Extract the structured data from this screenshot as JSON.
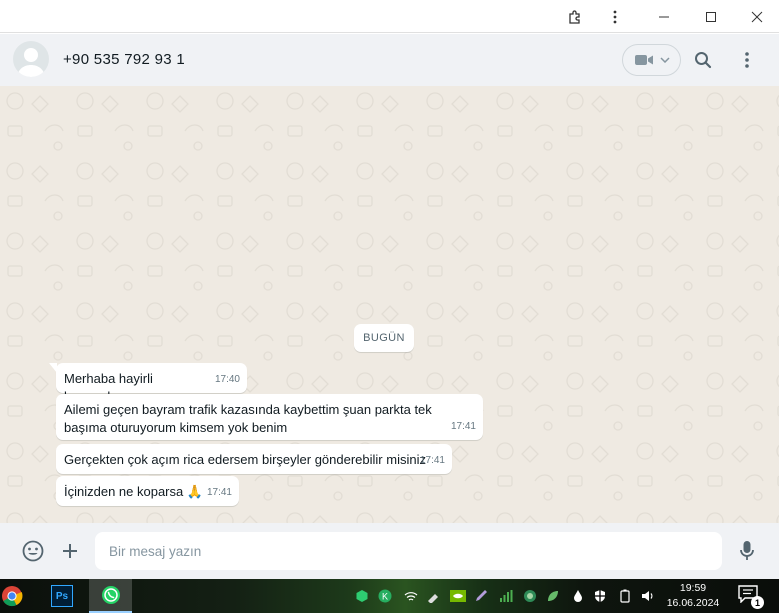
{
  "window": {
    "controls": [
      "extensions",
      "menu",
      "minimize",
      "maximize",
      "close"
    ]
  },
  "header": {
    "contact": "+90 535 792 93 1"
  },
  "chat": {
    "date_divider": "BUGÜN",
    "messages": [
      {
        "text": "Merhaba hayirli bayramlar",
        "time": "17:40"
      },
      {
        "text": "Ailemi geçen bayram trafik kazasında kaybettim şuan parkta tek başıma oturuyorum kimsem yok benim",
        "time": "17:41"
      },
      {
        "text": "Gerçekten çok açım rica edersem birşeyler gönderebilir misiniz",
        "time": "17:41"
      },
      {
        "text": "İçinizden ne koparsa 🙏",
        "time": "17:41"
      }
    ]
  },
  "composer": {
    "placeholder": "Bir mesaj yazın"
  },
  "taskbar": {
    "apps": [
      "chrome-icon",
      "photoshop-icon",
      "whatsapp-icon"
    ],
    "ps_label": "Ps",
    "clock_time": "19:59",
    "clock_date": "16.06.2024",
    "notification_count": "1"
  },
  "colors": {
    "chat_bg": "#efeae2",
    "header_bg": "#f0f2f5",
    "bubble": "#ffffff",
    "whatsapp_green": "#25d366"
  }
}
